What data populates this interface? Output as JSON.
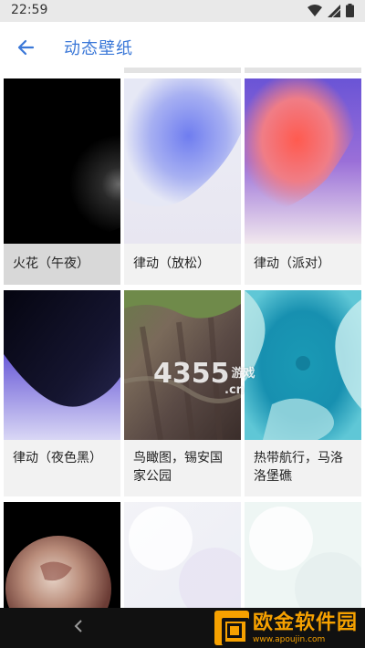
{
  "status_bar": {
    "time": "22:59"
  },
  "app_bar": {
    "title": "动态壁纸"
  },
  "wallpapers": [
    {
      "label": "火花（午夜）",
      "selected": true
    },
    {
      "label": "律动（放松）"
    },
    {
      "label": "律动（派对）"
    },
    {
      "label": "律动（夜色黑）"
    },
    {
      "label": "鸟瞰图，锡安国家公园"
    },
    {
      "label": "热带航行，马洛洛堡礁"
    },
    {
      "label": ""
    },
    {
      "label": ""
    },
    {
      "label": ""
    }
  ],
  "watermark": {
    "text": "4355",
    "suffix": "游戏",
    "domain": ".cn"
  },
  "brand": {
    "name": "欧金软件园",
    "url": "www.apoujin.com"
  }
}
